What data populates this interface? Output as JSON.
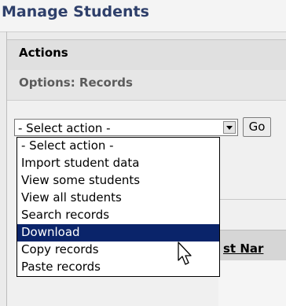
{
  "page": {
    "title": "Manage Students"
  },
  "actions": {
    "label": "Actions"
  },
  "options": {
    "label": "Options: Records"
  },
  "action_select": {
    "current_value": "- Select action -",
    "options": [
      "- Select action -",
      "Import student data",
      "View some students",
      "View all students",
      "Search records",
      "Download",
      "Copy records",
      "Paste records"
    ],
    "highlighted_option": "Download"
  },
  "go_button": {
    "label": "Go"
  },
  "table": {
    "partial_header": "st Nar"
  },
  "cursor": {
    "icon": "mouse-pointer-icon"
  },
  "colors": {
    "title": "#2e3f6a",
    "highlight": "#0a246a",
    "highlight_text": "#ffffff"
  }
}
